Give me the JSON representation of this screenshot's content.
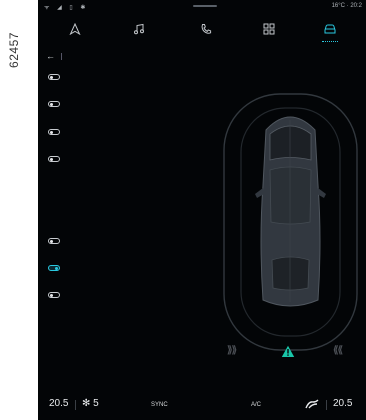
{
  "reference_code": "62457",
  "status_bar": {
    "left_icons": "ᯤ ◢ ▯ ✱",
    "right_text": "16°C · 20:2"
  },
  "nav": {
    "items": [
      "navigation-icon",
      "music-icon",
      "phone-icon",
      "apps-icon",
      "car-icon"
    ],
    "active": "car-icon",
    "accent_color": "#2ac9e0"
  },
  "back_label": "←",
  "toggles": [
    {
      "on": false
    },
    {
      "on": false
    },
    {
      "on": false
    },
    {
      "on": false
    },
    {
      "on": false
    },
    {
      "on": true
    },
    {
      "on": false
    }
  ],
  "parking_scene": {
    "left_chevrons": "⟫⟫",
    "right_chevrons": "⟪⟪",
    "warning_color": "#19c6a9"
  },
  "bottom_bar": {
    "left_temp": "20.5",
    "fan_speed": "5",
    "sync_label": "SYNC",
    "ac_label": "A/C",
    "right_temp": "20.5"
  }
}
